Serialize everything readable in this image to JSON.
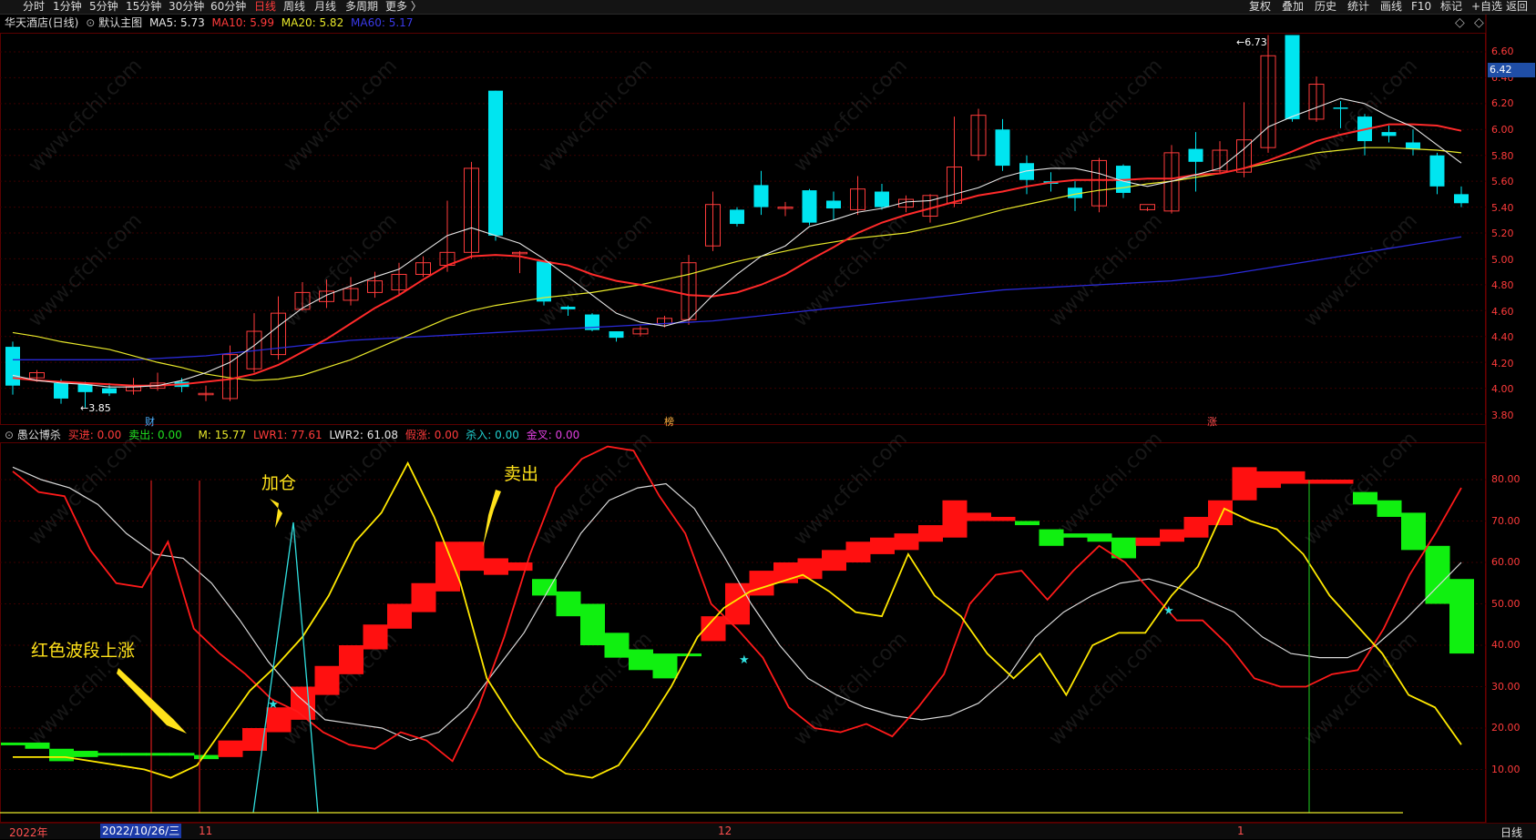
{
  "toolbar": {
    "timeframes": [
      "分时",
      "1分钟",
      "5分钟",
      "15分钟",
      "30分钟",
      "60分钟",
      "日线",
      "周线",
      "月线",
      "多周期",
      "更多 〉"
    ],
    "active_timeframe": "日线",
    "tools": [
      "复权",
      "叠加",
      "历史",
      "统计",
      "画线",
      "F10",
      "标记",
      "+自选",
      "返回"
    ],
    "nav_left": "◇",
    "nav_right": "◇"
  },
  "main_chart": {
    "title": "华天酒店(日线)",
    "template": "默认主图",
    "ma5": "MA5: 5.73",
    "ma10": "MA10: 5.99",
    "ma20": "MA20: 5.82",
    "ma60": "MA60: 5.17",
    "scale_labels": [
      "6.60",
      "6.40",
      "6.20",
      "6.00",
      "5.80",
      "5.60",
      "5.40",
      "5.20",
      "5.00",
      "4.80",
      "4.60",
      "4.40",
      "4.20",
      "4.00",
      "3.80"
    ],
    "current_price": "6.42",
    "high_label": "6.73",
    "low_label": "3.85",
    "markers": [
      {
        "text": "财",
        "color": "#4fb0ff"
      },
      {
        "text": "榜",
        "color": "#ffb040"
      },
      {
        "text": "涨",
        "color": "#ff5050"
      }
    ]
  },
  "indicator": {
    "name": "愚公博杀",
    "buy_in": "买进: 0.00",
    "sell_out": "卖出: 0.00",
    "m": "M: 15.77",
    "lwr1": "LWR1: 77.61",
    "lwr2": "LWR2: 61.08",
    "fake_up": "假涨: 0.00",
    "kill_in": "杀入: 0.00",
    "full_cross": "金叉: 0.00",
    "scale_labels": [
      "80.00",
      "70.00",
      "60.00",
      "50.00",
      "40.00",
      "30.00",
      "20.00",
      "10.00"
    ],
    "annotations": {
      "add": "加仓",
      "sell": "卖出",
      "red_wave": "红色波段上涨"
    }
  },
  "bottom_bar": {
    "year": "2022年",
    "date_cursor": "2022/10/26/三",
    "month_11": "11",
    "month_12": "12",
    "month_1": "1",
    "period": "日线"
  },
  "watermark": "www.cfchi.com",
  "colors": {
    "up_candle": "#ff3b3b",
    "down_candle": "#00e5f0",
    "ma5": "#e6e6e6",
    "ma10": "#ff2a2a",
    "ma20": "#e8e82a",
    "ma60": "#2a2ad8",
    "bar_red": "#ff1010",
    "bar_green": "#10f010"
  },
  "candles": [
    [
      4.32,
      4.02,
      3.95,
      4.36
    ],
    [
      4.08,
      4.12,
      4.05,
      4.14
    ],
    [
      4.04,
      3.92,
      3.88,
      4.07
    ],
    [
      4.03,
      3.97,
      3.85,
      4.05
    ],
    [
      4.0,
      3.96,
      3.94,
      4.04
    ],
    [
      3.98,
      4.01,
      3.95,
      4.08
    ],
    [
      4.0,
      4.04,
      3.98,
      4.12
    ],
    [
      4.05,
      4.01,
      3.97,
      4.08
    ],
    [
      3.96,
      3.96,
      3.9,
      4.02
    ],
    [
      3.92,
      4.26,
      3.9,
      4.33
    ],
    [
      4.15,
      4.44,
      4.12,
      4.58
    ],
    [
      4.26,
      4.58,
      4.22,
      4.71
    ],
    [
      4.61,
      4.74,
      4.6,
      4.82
    ],
    [
      4.67,
      4.75,
      4.62,
      4.84
    ],
    [
      4.68,
      4.77,
      4.64,
      4.86
    ],
    [
      4.74,
      4.83,
      4.7,
      4.9
    ],
    [
      4.76,
      4.88,
      4.72,
      4.97
    ],
    [
      4.88,
      4.97,
      4.86,
      5.02
    ],
    [
      4.95,
      5.05,
      4.9,
      5.45
    ],
    [
      5.05,
      5.7,
      5.0,
      5.75
    ],
    [
      6.3,
      5.18,
      5.14,
      6.3
    ],
    [
      5.04,
      5.05,
      4.89,
      5.06
    ],
    [
      4.98,
      4.67,
      4.64,
      4.98
    ],
    [
      4.63,
      4.61,
      4.56,
      4.64
    ],
    [
      4.57,
      4.45,
      4.44,
      4.58
    ],
    [
      4.44,
      4.39,
      4.36,
      4.44
    ],
    [
      4.42,
      4.46,
      4.4,
      4.48
    ],
    [
      4.5,
      4.54,
      4.47,
      4.56
    ],
    [
      4.53,
      4.97,
      4.49,
      5.03
    ],
    [
      5.1,
      5.42,
      5.06,
      5.52
    ],
    [
      5.38,
      5.27,
      5.25,
      5.4
    ],
    [
      5.57,
      5.4,
      5.34,
      5.68
    ],
    [
      5.4,
      5.4,
      5.33,
      5.44
    ],
    [
      5.53,
      5.28,
      5.26,
      5.54
    ],
    [
      5.45,
      5.39,
      5.3,
      5.52
    ],
    [
      5.38,
      5.54,
      5.34,
      5.64
    ],
    [
      5.52,
      5.4,
      5.38,
      5.58
    ],
    [
      5.4,
      5.46,
      5.36,
      5.49
    ],
    [
      5.33,
      5.49,
      5.28,
      5.5
    ],
    [
      5.43,
      5.71,
      5.4,
      6.1
    ],
    [
      5.8,
      6.11,
      5.76,
      6.16
    ],
    [
      6.0,
      5.72,
      5.68,
      6.08
    ],
    [
      5.74,
      5.61,
      5.5,
      5.8
    ],
    [
      5.6,
      5.58,
      5.52,
      5.67
    ],
    [
      5.55,
      5.47,
      5.37,
      5.6
    ],
    [
      5.41,
      5.76,
      5.36,
      5.78
    ],
    [
      5.72,
      5.51,
      5.47,
      5.73
    ],
    [
      5.38,
      5.42,
      5.37,
      5.4
    ],
    [
      5.37,
      5.82,
      5.35,
      5.88
    ],
    [
      5.85,
      5.75,
      5.52,
      5.98
    ],
    [
      5.68,
      5.84,
      5.66,
      5.91
    ],
    [
      5.67,
      5.92,
      5.63,
      6.21
    ],
    [
      5.86,
      6.57,
      5.82,
      6.73
    ],
    [
      6.73,
      6.08,
      6.06,
      6.73
    ],
    [
      6.08,
      6.35,
      6.06,
      6.41
    ],
    [
      6.17,
      6.16,
      6.01,
      6.22
    ],
    [
      6.1,
      5.91,
      5.8,
      6.12
    ],
    [
      5.98,
      5.95,
      5.9,
      6.03
    ],
    [
      5.9,
      5.85,
      5.8,
      6.0
    ],
    [
      5.8,
      5.56,
      5.5,
      5.82
    ],
    [
      5.5,
      5.43,
      5.4,
      5.56
    ]
  ],
  "ma5_values": [
    4.1,
    4.06,
    4.04,
    4.03,
    4.01,
    4.01,
    4.02,
    4.06,
    4.12,
    4.2,
    4.33,
    4.48,
    4.62,
    4.72,
    4.79,
    4.86,
    4.92,
    5.05,
    5.18,
    5.24,
    5.18,
    5.12,
    5.0,
    4.86,
    4.72,
    4.58,
    4.51,
    4.48,
    4.53,
    4.72,
    4.88,
    5.02,
    5.1,
    5.25,
    5.3,
    5.36,
    5.39,
    5.44,
    5.45,
    5.5,
    5.55,
    5.63,
    5.68,
    5.7,
    5.7,
    5.66,
    5.6,
    5.56,
    5.6,
    5.65,
    5.7,
    5.85,
    6.02,
    6.1,
    6.17,
    6.24,
    6.2,
    6.1,
    6.02,
    5.88,
    5.74
  ],
  "ma10_values": [
    4.08,
    4.06,
    4.05,
    4.04,
    4.03,
    4.02,
    4.02,
    4.03,
    4.05,
    4.07,
    4.11,
    4.18,
    4.28,
    4.38,
    4.5,
    4.62,
    4.72,
    4.84,
    4.95,
    5.02,
    5.03,
    5.02,
    4.98,
    4.95,
    4.88,
    4.83,
    4.8,
    4.76,
    4.72,
    4.71,
    4.74,
    4.8,
    4.88,
    4.99,
    5.09,
    5.2,
    5.28,
    5.34,
    5.39,
    5.44,
    5.49,
    5.52,
    5.56,
    5.59,
    5.61,
    5.61,
    5.61,
    5.62,
    5.62,
    5.65,
    5.66,
    5.7,
    5.76,
    5.83,
    5.91,
    5.96,
    6.0,
    6.04,
    6.04,
    6.03,
    5.99
  ],
  "ma20_values": [
    4.43,
    4.4,
    4.36,
    4.33,
    4.3,
    4.25,
    4.2,
    4.16,
    4.11,
    4.08,
    4.06,
    4.07,
    4.1,
    4.16,
    4.22,
    4.3,
    4.38,
    4.46,
    4.54,
    4.6,
    4.64,
    4.67,
    4.7,
    4.72,
    4.74,
    4.77,
    4.8,
    4.84,
    4.88,
    4.93,
    4.98,
    5.02,
    5.06,
    5.1,
    5.13,
    5.16,
    5.18,
    5.2,
    5.24,
    5.28,
    5.33,
    5.38,
    5.42,
    5.46,
    5.5,
    5.53,
    5.55,
    5.58,
    5.6,
    5.63,
    5.66,
    5.7,
    5.74,
    5.78,
    5.82,
    5.84,
    5.86,
    5.86,
    5.85,
    5.84,
    5.82
  ],
  "ma60_values": [
    4.22,
    4.22,
    4.22,
    4.22,
    4.22,
    4.22,
    4.23,
    4.24,
    4.25,
    4.27,
    4.29,
    4.31,
    4.33,
    4.35,
    4.37,
    4.38,
    4.39,
    4.4,
    4.41,
    4.42,
    4.43,
    4.44,
    4.45,
    4.46,
    4.47,
    4.48,
    4.49,
    4.5,
    4.51,
    4.52,
    4.54,
    4.56,
    4.58,
    4.6,
    4.62,
    4.64,
    4.66,
    4.68,
    4.7,
    4.72,
    4.74,
    4.76,
    4.77,
    4.78,
    4.79,
    4.8,
    4.81,
    4.82,
    4.83,
    4.85,
    4.87,
    4.9,
    4.93,
    4.96,
    4.99,
    5.02,
    5.05,
    5.08,
    5.11,
    5.14,
    5.17
  ],
  "ind_bars": [
    [
      16.5,
      16.0,
      0
    ],
    [
      16.5,
      15.0,
      0
    ],
    [
      15.0,
      12.0,
      0
    ],
    [
      14.5,
      13.0,
      0
    ],
    [
      14.0,
      13.5,
      0
    ],
    [
      14.0,
      13.5,
      0
    ],
    [
      14.0,
      14.0,
      0
    ],
    [
      14.0,
      13.5,
      0
    ],
    [
      13.5,
      12.5,
      0
    ],
    [
      13.0,
      17.0,
      1
    ],
    [
      14.5,
      20.0,
      1
    ],
    [
      19.0,
      25.0,
      1
    ],
    [
      22.0,
      30.0,
      1
    ],
    [
      28.0,
      35.0,
      1
    ],
    [
      33.0,
      40.0,
      1
    ],
    [
      39.0,
      45.0,
      1
    ],
    [
      44.0,
      50.0,
      1
    ],
    [
      48.0,
      55.0,
      1
    ],
    [
      53.0,
      65.0,
      1
    ],
    [
      58.0,
      65.0,
      1
    ],
    [
      57.0,
      61.0,
      1
    ],
    [
      58.0,
      60.0,
      1
    ],
    [
      56.0,
      52.0,
      0
    ],
    [
      53.0,
      47.0,
      0
    ],
    [
      50.0,
      40.0,
      0
    ],
    [
      43.0,
      37.0,
      0
    ],
    [
      39.0,
      34.0,
      0
    ],
    [
      38.0,
      32.0,
      0
    ],
    [
      38.0,
      38.0,
      0
    ],
    [
      41.0,
      47.0,
      1
    ],
    [
      45.0,
      55.0,
      1
    ],
    [
      52.0,
      58.0,
      1
    ],
    [
      55.0,
      60.0,
      1
    ],
    [
      56.0,
      61.0,
      1
    ],
    [
      58.0,
      63.0,
      1
    ],
    [
      60.0,
      65.0,
      1
    ],
    [
      62.0,
      66.0,
      1
    ],
    [
      63.0,
      67.0,
      1
    ],
    [
      65.0,
      69.0,
      1
    ],
    [
      66.0,
      75.0,
      1
    ],
    [
      70.0,
      72.0,
      1
    ],
    [
      70.0,
      71.0,
      1
    ],
    [
      70.0,
      69.0,
      0
    ],
    [
      68.0,
      64.0,
      0
    ],
    [
      67.0,
      66.0,
      0
    ],
    [
      67.0,
      65.0,
      0
    ],
    [
      66.0,
      61.0,
      0
    ],
    [
      64.0,
      66.0,
      1
    ],
    [
      65.0,
      68.0,
      1
    ],
    [
      66.0,
      71.0,
      1
    ],
    [
      69.0,
      75.0,
      1
    ],
    [
      75.0,
      83.0,
      1
    ],
    [
      78.0,
      82.0,
      1
    ],
    [
      79.0,
      82.0,
      1
    ],
    [
      79.0,
      80.0,
      1
    ],
    [
      80.0,
      79.0,
      1
    ],
    [
      77.0,
      74.0,
      0
    ],
    [
      75.0,
      71.0,
      0
    ],
    [
      72.0,
      63.0,
      0
    ],
    [
      64.0,
      50.0,
      0
    ],
    [
      56.0,
      38.0,
      0
    ]
  ],
  "ind_lwr1": [
    82,
    77,
    76,
    63,
    55,
    54,
    65,
    44,
    38,
    33,
    27,
    24,
    19,
    16,
    15,
    19,
    17,
    12,
    25,
    42,
    62,
    78,
    85,
    88,
    87,
    76,
    67,
    50,
    44,
    37,
    25,
    20,
    19,
    21,
    18,
    25,
    33,
    50,
    57,
    58,
    51,
    58,
    64,
    60,
    53,
    46,
    46,
    40,
    32,
    30,
    30,
    33,
    34,
    44,
    57,
    67,
    78
  ],
  "ind_lwr2": [
    83,
    80,
    78,
    74,
    67,
    62,
    61,
    55,
    46,
    36,
    28,
    22,
    21,
    20,
    17,
    19,
    25,
    34,
    43,
    55,
    67,
    75,
    78,
    79,
    73,
    62,
    50,
    40,
    32,
    28,
    25,
    23,
    22,
    23,
    26,
    32,
    42,
    48,
    52,
    55,
    56,
    54,
    51,
    48,
    42,
    38,
    37,
    37,
    40,
    46,
    53,
    60
  ],
  "ind_m": [
    13,
    13,
    13,
    12,
    11,
    10,
    8,
    11,
    20,
    29,
    35,
    42,
    52,
    65,
    72,
    84,
    71,
    55,
    32,
    22,
    13,
    9,
    8,
    11,
    20,
    30,
    42,
    49,
    53,
    55,
    57,
    53,
    48,
    47,
    62,
    52,
    47,
    38,
    32,
    38,
    28,
    40,
    43,
    43,
    52,
    59,
    73,
    70,
    68,
    62,
    52,
    45,
    38,
    28,
    25,
    16
  ]
}
